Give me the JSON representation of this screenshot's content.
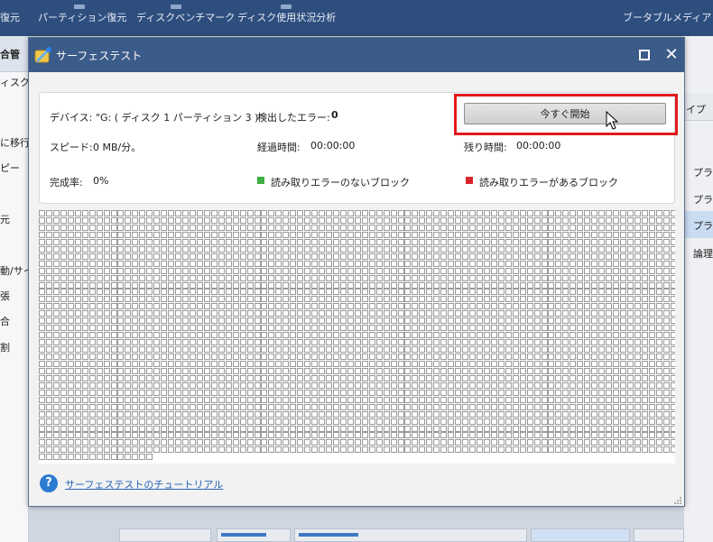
{
  "app": {
    "toolbar": [
      {
        "label": "復元"
      },
      {
        "label": "パーティション復元"
      },
      {
        "label": "ディスクベンチマーク"
      },
      {
        "label": "ディスク使用状況分析"
      },
      {
        "label": "ブータブルメディア"
      }
    ],
    "left_panel": {
      "heading": "合管",
      "lines": [
        "ィスク",
        "に移行",
        "ピー",
        "元",
        "動/サイ",
        "張",
        "合",
        "割"
      ]
    },
    "right_panel": {
      "lines": [
        "イプ",
        "プライ",
        "プライ",
        "プライ",
        "論理"
      ]
    }
  },
  "dialog": {
    "title": "サーフェステスト",
    "device_label": "デバイス:",
    "device_value": "\"G: ( ディスク 1 パーティション 3 )\"",
    "errors_label": "検出したエラー:",
    "errors_value": "0",
    "start_button": "今すぐ開始",
    "speed_label": "スピード:",
    "speed_value": "0 MB/分。",
    "elapsed_label": "経過時間:",
    "elapsed_value": "00:00:00",
    "remaining_label": "残り時間:",
    "remaining_value": "00:00:00",
    "completion_label": "完成率:",
    "completion_value": "0%",
    "legend_ok": "読み取りエラーのないブロック",
    "legend_error": "読み取りエラーがあるブロック",
    "colors": {
      "ok": "#3cb043",
      "error": "#d9232b",
      "highlight": "#e3191c",
      "titlebar": "#3b5b89"
    },
    "block_progress": 0,
    "tutorial_link": "サーフェステストのチュートリアル"
  }
}
